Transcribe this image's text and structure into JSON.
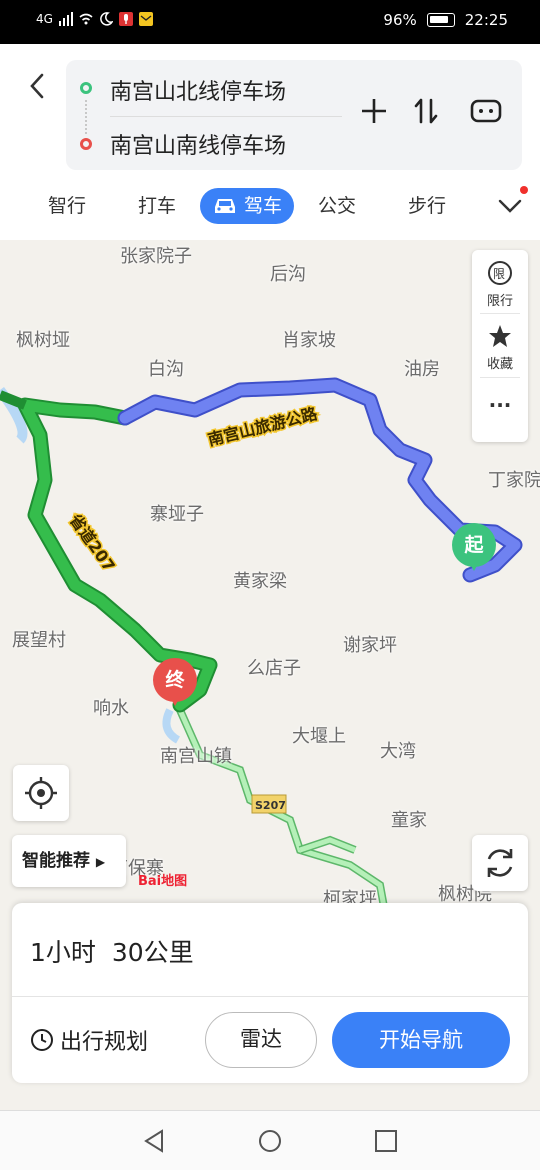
{
  "status_bar": {
    "network": "4G",
    "battery_percent": "96%",
    "time": "22:25"
  },
  "route": {
    "start": "南宫山北线停车场",
    "end": "南宫山南线停车场"
  },
  "tabs": [
    {
      "label": "智行"
    },
    {
      "label": "打车"
    },
    {
      "label": "驾车",
      "active": true
    },
    {
      "label": "公交"
    },
    {
      "label": "步行"
    }
  ],
  "side_tools": {
    "limit_label": "限行",
    "limit_glyph": "限",
    "favorite_label": "收藏",
    "more_label": "···"
  },
  "map": {
    "places": [
      {
        "id": "zhangjiayuanzi",
        "name": "张家院子"
      },
      {
        "id": "hougou",
        "name": "后沟"
      },
      {
        "id": "fengshuya",
        "name": "枫树垭"
      },
      {
        "id": "xiaojiapo",
        "name": "肖家坡"
      },
      {
        "id": "baigou",
        "name": "白沟"
      },
      {
        "id": "youfang",
        "name": "油房"
      },
      {
        "id": "dingjiayuan",
        "name": "丁家院"
      },
      {
        "id": "zhaiyazi",
        "name": "寨垭子"
      },
      {
        "id": "huangjialiang",
        "name": "黄家梁"
      },
      {
        "id": "zhanwangcun",
        "name": "展望村"
      },
      {
        "id": "xiejiaping",
        "name": "谢家坪"
      },
      {
        "id": "yaodianzi",
        "name": "么店子"
      },
      {
        "id": "xiangshui",
        "name": "响水"
      },
      {
        "id": "dayanshang",
        "name": "大堰上"
      },
      {
        "id": "nangongshanzhen",
        "name": "南宫山镇"
      },
      {
        "id": "dawan",
        "name": "大湾"
      },
      {
        "id": "tongjia",
        "name": "童家"
      },
      {
        "id": "shibaozhai",
        "name": "石保寨"
      },
      {
        "id": "fengshuyuan",
        "name": "枫树院"
      },
      {
        "id": "kejiaping",
        "name": "柯家坪"
      }
    ],
    "road_labels": {
      "tourist_road": "南宫山旅游公路",
      "provincial_road": "省道207",
      "s207_badge": "S207"
    },
    "start_marker": "起",
    "end_marker": "终",
    "smart_recommend": "智能推荐",
    "logo_text": "Bai地图"
  },
  "summary": {
    "duration": "1小时",
    "distance": "30公里"
  },
  "actions": {
    "plan": "出行规划",
    "radar": "雷达",
    "start_nav": "开始导航"
  },
  "colors": {
    "accent": "#3a81f7",
    "route_blue": "#6c7ff0",
    "route_green": "#2fb54a",
    "alt_route": "#9fe3a3",
    "start_pin": "#3cc37e",
    "end_pin": "#e8504b"
  }
}
